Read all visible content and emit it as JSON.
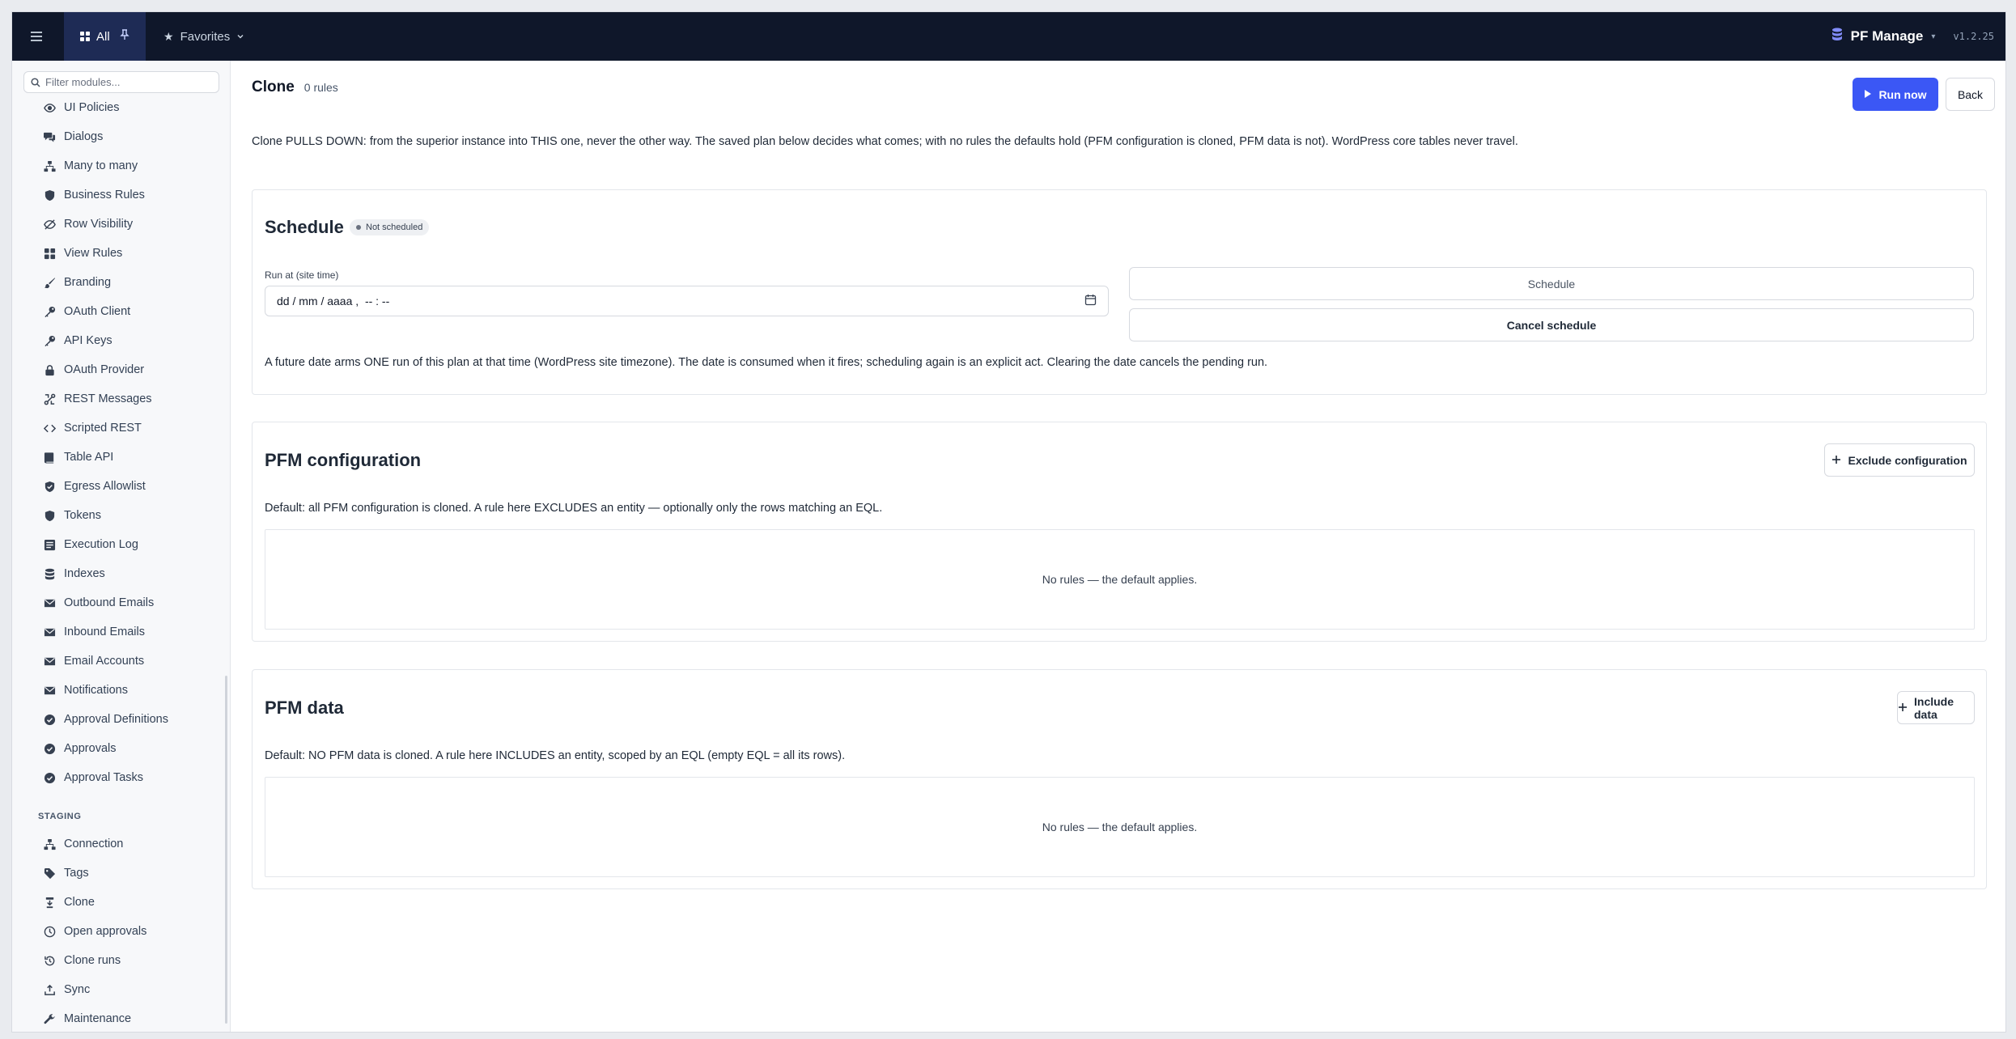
{
  "topbar": {
    "tab_all": "All",
    "tab_favorites": "Favorites",
    "brand": "PF Manage",
    "version": "v1.2.25"
  },
  "sidebar": {
    "filter_placeholder": "Filter modules...",
    "items": [
      {
        "label": "UI Policies",
        "icon": "eye-icon"
      },
      {
        "label": "Dialogs",
        "icon": "chat-icon"
      },
      {
        "label": "Many to many",
        "icon": "hierarchy-icon"
      },
      {
        "label": "Business Rules",
        "icon": "shield-icon"
      },
      {
        "label": "Row Visibility",
        "icon": "eye-off-icon"
      },
      {
        "label": "View Rules",
        "icon": "grid-icon"
      },
      {
        "label": "Branding",
        "icon": "brush-icon"
      },
      {
        "label": "OAuth Client",
        "icon": "key-icon"
      },
      {
        "label": "API Keys",
        "icon": "key-icon"
      },
      {
        "label": "OAuth Provider",
        "icon": "lock-icon"
      },
      {
        "label": "REST Messages",
        "icon": "route-icon"
      },
      {
        "label": "Scripted REST",
        "icon": "code-icon"
      },
      {
        "label": "Table API",
        "icon": "book-icon"
      },
      {
        "label": "Egress Allowlist",
        "icon": "shield-check-icon"
      },
      {
        "label": "Tokens",
        "icon": "shield-icon"
      },
      {
        "label": "Execution Log",
        "icon": "log-icon"
      },
      {
        "label": "Indexes",
        "icon": "database-icon"
      },
      {
        "label": "Outbound Emails",
        "icon": "mail-icon"
      },
      {
        "label": "Inbound Emails",
        "icon": "mail-icon"
      },
      {
        "label": "Email Accounts",
        "icon": "mail-icon"
      },
      {
        "label": "Notifications",
        "icon": "mail-icon"
      },
      {
        "label": "Approval Definitions",
        "icon": "check-circle-icon"
      },
      {
        "label": "Approvals",
        "icon": "check-circle-icon"
      },
      {
        "label": "Approval Tasks",
        "icon": "check-circle-icon"
      }
    ],
    "section_label": "STAGING",
    "staging_items": [
      {
        "label": "Connection",
        "icon": "hierarchy-icon"
      },
      {
        "label": "Tags",
        "icon": "tag-icon"
      },
      {
        "label": "Clone",
        "icon": "clone-icon"
      },
      {
        "label": "Open approvals",
        "icon": "clock-icon"
      },
      {
        "label": "Clone runs",
        "icon": "history-icon"
      },
      {
        "label": "Sync",
        "icon": "upload-icon"
      },
      {
        "label": "Maintenance",
        "icon": "wrench-icon"
      }
    ]
  },
  "main": {
    "title": "Clone",
    "rule_count": "0 rules",
    "run_now": "Run now",
    "back": "Back",
    "intro": "Clone PULLS DOWN: from the superior instance into THIS one, never the other way. The saved plan below decides what comes; with no rules the defaults hold (PFM configuration is cloned, PFM data is not). WordPress core tables never travel."
  },
  "schedule": {
    "title": "Schedule",
    "status": "Not scheduled",
    "run_at_label": "Run at (site time)",
    "date_value": "dd / mm / aaaa ,  -- : --",
    "schedule_button": "Schedule",
    "cancel_button": "Cancel schedule",
    "description": "A future date arms ONE run of this plan at that time (WordPress site timezone). The date is consumed when it fires; scheduling again is an explicit act. Clearing the date cancels the pending run."
  },
  "config": {
    "title": "PFM configuration",
    "button": "Exclude configuration",
    "description": "Default: all PFM configuration is cloned. A rule here EXCLUDES an entity — optionally only the rows matching an EQL.",
    "empty": "No rules — the default applies."
  },
  "data_section": {
    "title": "PFM data",
    "button": "Include data",
    "description": "Default: NO PFM data is cloned. A rule here INCLUDES an entity, scoped by an EQL (empty EQL = all its rows).",
    "empty": "No rules — the default applies."
  },
  "colors": {
    "topbar": "#0f172a",
    "active_tab": "#1e2b55",
    "primary": "#3b57f5"
  }
}
